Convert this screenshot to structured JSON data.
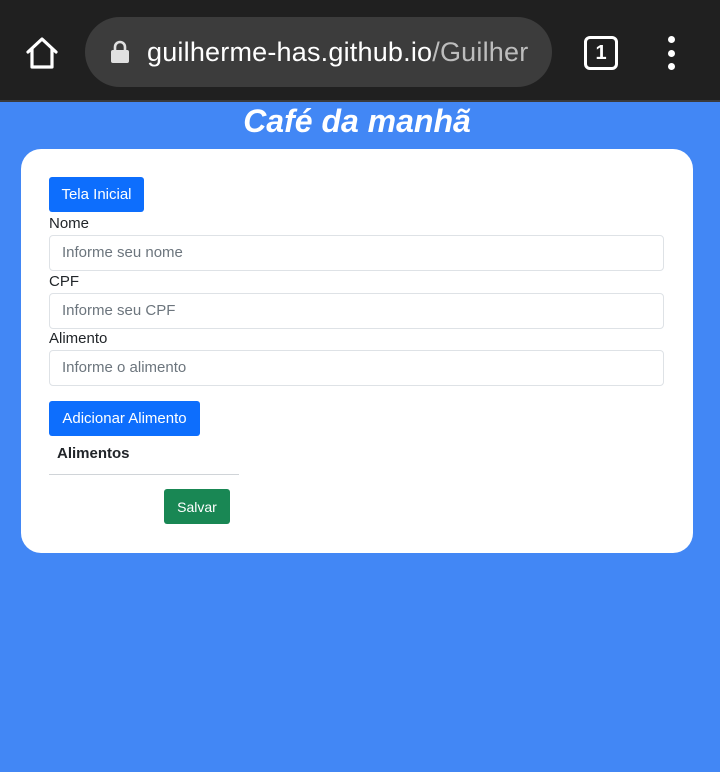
{
  "browser": {
    "url_host": "guilherme-has.github.io",
    "url_path": "/Guilher",
    "tab_count": "1"
  },
  "page": {
    "title": "Café da manhã"
  },
  "form": {
    "home_button": "Tela Inicial",
    "name_label": "Nome",
    "name_placeholder": "Informe seu nome",
    "cpf_label": "CPF",
    "cpf_placeholder": "Informe seu CPF",
    "food_label": "Alimento",
    "food_placeholder": "Informe o alimento",
    "add_button": "Adicionar Alimento",
    "table_header": "Alimentos",
    "save_button": "Salvar"
  },
  "colors": {
    "background": "#4287f5",
    "primary": "#0d6efd",
    "success": "#198754"
  }
}
